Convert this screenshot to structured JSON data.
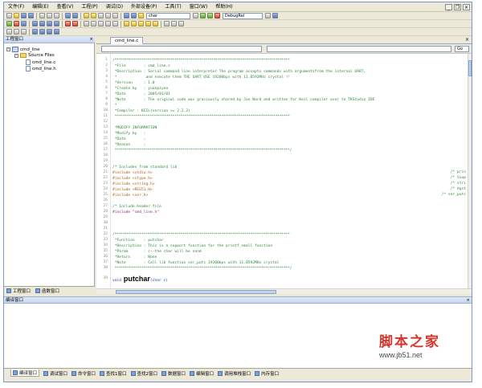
{
  "menu": {
    "items": [
      "文件(F)",
      "编辑(E)",
      "查看(V)",
      "工程(P)",
      "调试(D)",
      "外部设备(P)",
      "工具(T)",
      "窗口(W)",
      "帮助(H)"
    ]
  },
  "toolbar": {
    "search_value": "char",
    "config_value": "DebugRel"
  },
  "project": {
    "title": "工程窗口",
    "root": "cmd_line",
    "folder": "Source Files",
    "files": [
      "cmd_line.c",
      "cmd_line.h"
    ],
    "tabs": [
      "工程窗口",
      "函数窗口"
    ]
  },
  "editor": {
    "tab_label": "cmd_line.c",
    "nav_right": "Go",
    "lines": [
      "/*************************************************************************************",
      " *File        : cmd_line.c",
      " *Description : Serial command line interpreter The program accepts commands with argumentsfrom the internal UART,",
      " *             and execute them THE UART USE 19200bps with 11.0592MHz crystal !!",
      " *Version     : 1.0",
      " *Create by   : yuanpiyea",
      " *Date        : 2005/01/01",
      " *Note        : The original code was graciously shared by Jon Ward and written for Keil compiler over to TKStudio IDE",
      " *",
      " *Compiler : KEIL(version >= 2.2.2)",
      " *************************************************************************************",
      "",
      " *MODIFY INFORMATION",
      " *Modify by   :",
      " *Date        :",
      " *Reason      :",
      " *************************************************************************************/",
      "",
      "",
      "/* Includes from standard lib",
      "#include <stdio.h>",
      "#include <ctype.h>",
      "#include <string.h>",
      "#include <REG51.H>",
      "#include <ser.h>",
      "",
      "/* Include header file",
      "#include \"cmd_line.h\"",
      "",
      "",
      "",
      "/*************************************************************************************",
      " *Function    : putchar",
      " *Description : This is a support function for the printf_small function",
      " *Param       : c--the char will be send",
      " *Return      : None",
      " *Note        : Call lib function ser_putc 19200bps with 11.0592MHz crystal",
      " *************************************************************************************/"
    ],
    "right_comments": [
      "/* prin",
      "/* tuup",
      "/* stri",
      "/* dgst",
      "/* ser_putc"
    ],
    "last_line": {
      "prefix": "void ",
      "name": "putchar",
      "suffix": "(char c)"
    }
  },
  "output": {
    "title": "编译窗口",
    "tabs": [
      "编译窗口",
      "调试窗口",
      "命令窗口",
      "查找1窗口",
      "查找2窗口",
      "数据窗口",
      "编辑窗口",
      "调用堆栈窗口",
      "内存窗口"
    ]
  },
  "watermark": {
    "logo": "脚本之家",
    "url": "www.jb51.net"
  }
}
